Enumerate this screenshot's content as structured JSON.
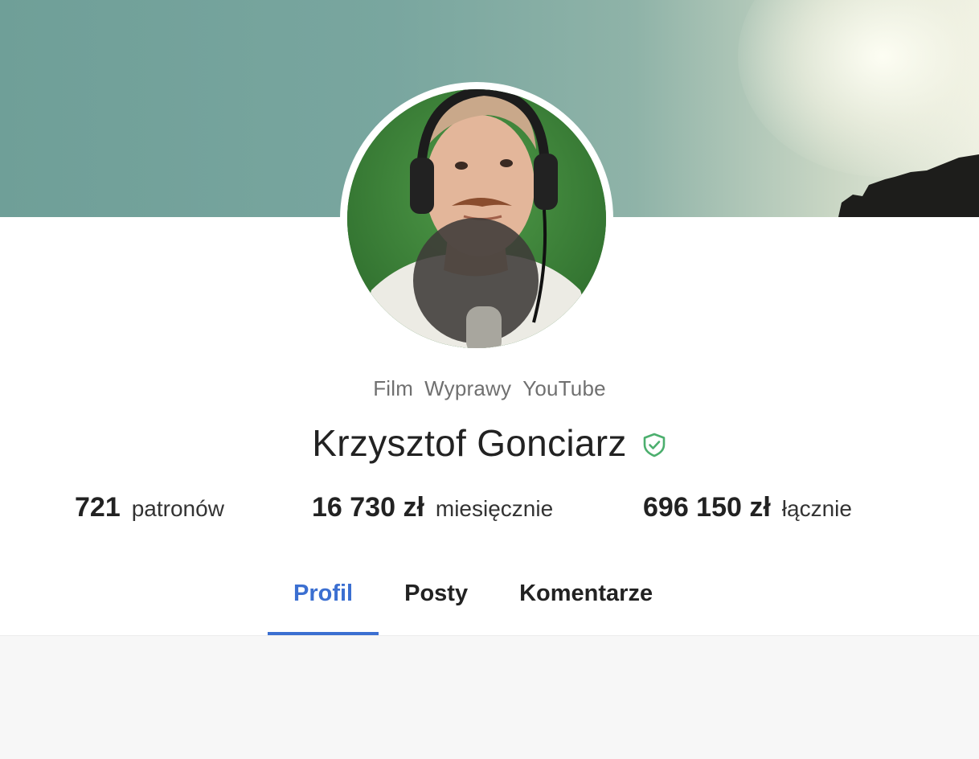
{
  "profile": {
    "categories": [
      "Film",
      "Wyprawy",
      "YouTube"
    ],
    "name": "Krzysztof Gonciarz",
    "verified_icon": "shield-check-icon"
  },
  "stats": [
    {
      "value": "721",
      "label": "patronów"
    },
    {
      "value": "16 730 zł",
      "label": "miesięcznie"
    },
    {
      "value": "696 150 zł",
      "label": "łącznie"
    }
  ],
  "tabs": [
    {
      "label": "Profil",
      "active": true
    },
    {
      "label": "Posty",
      "active": false
    },
    {
      "label": "Komentarze",
      "active": false
    }
  ],
  "colors": {
    "accent": "#3b6fd1",
    "verified": "#4caf6e"
  }
}
